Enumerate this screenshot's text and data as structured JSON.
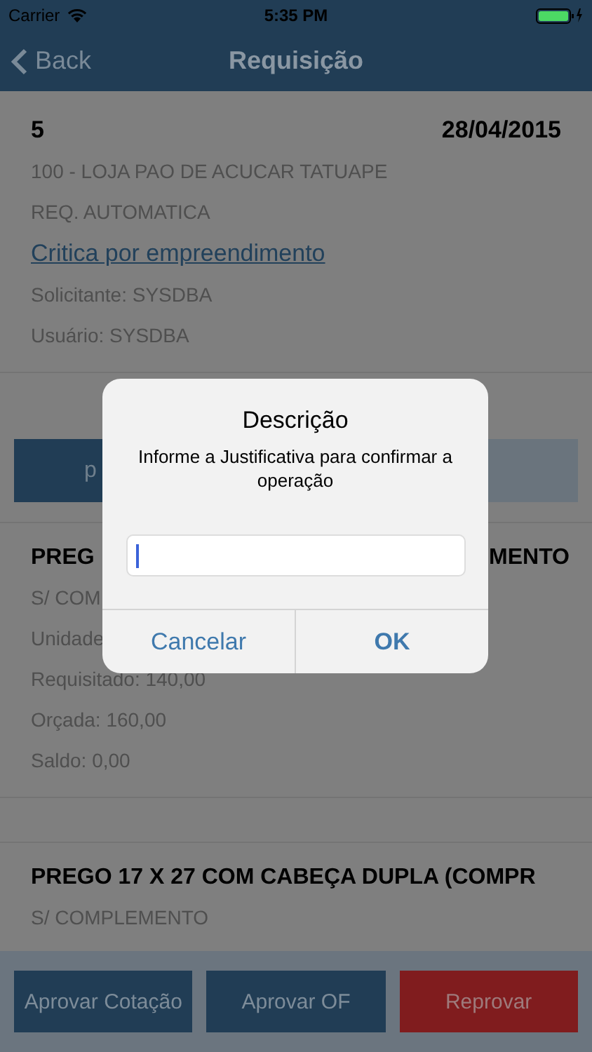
{
  "status_bar": {
    "carrier": "Carrier",
    "time": "5:35 PM"
  },
  "nav": {
    "back": "Back",
    "title": "Requisição"
  },
  "header": {
    "number": "5",
    "date": "28/04/2015",
    "store": "100 - LOJA PAO DE ACUCAR TATUAPE",
    "type": "REQ. AUTOMATICA",
    "link": "Critica por empreendimento",
    "requester": "Solicitante: SYSDBA",
    "user": "Usuário: SYSDBA"
  },
  "segment_buttons": [
    {
      "label": "p",
      "kind": "primary"
    },
    {
      "kind": "secondary"
    }
  ],
  "items": [
    {
      "title_parts": [
        "PREG",
        "MENTO"
      ],
      "lines": [
        "S/ COM",
        "Unidade",
        "Requisitado: 140,00",
        "Orçada: 160,00",
        "Saldo: 0,00"
      ]
    },
    {
      "title_parts": [
        "PREGO 17 X 27 COM CABEÇA DUPLA (COMPR"
      ],
      "lines": [
        "S/ COMPLEMENTO"
      ]
    }
  ],
  "dialog": {
    "title": "Descrição",
    "message": "Informe a Justificativa para confirmar a operação",
    "buttons": [
      {
        "label": "Cancelar",
        "kind": "cancel"
      },
      {
        "label": "OK",
        "kind": "default"
      }
    ]
  },
  "bottom_buttons": [
    {
      "label": "Aprovar Cotação",
      "kind": "approve"
    },
    {
      "label": "Aprovar OF",
      "kind": "approve"
    },
    {
      "label": "Reprovar",
      "kind": "reject"
    }
  ]
}
